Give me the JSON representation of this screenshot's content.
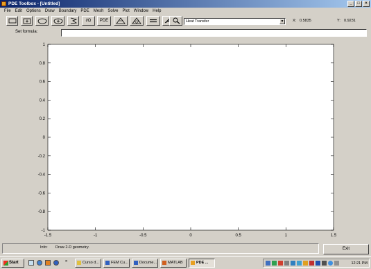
{
  "window": {
    "title": "PDE Toolbox - [Untitled]"
  },
  "window_buttons": [
    "_",
    "□",
    "×"
  ],
  "menu": [
    "File",
    "Edit",
    "Options",
    "Draw",
    "Boundary",
    "PDE",
    "Mesh",
    "Solve",
    "Plot",
    "Window",
    "Help"
  ],
  "toolbar": {
    "buttons": [
      {
        "name": "rectangle-icon"
      },
      {
        "name": "rectangle-centered-icon"
      },
      {
        "name": "ellipse-icon"
      },
      {
        "name": "ellipse-centered-icon"
      },
      {
        "name": "polygon-icon"
      },
      {
        "name": "boundary-mode-button",
        "label": "∂Ω"
      },
      {
        "name": "pde-spec-button",
        "label": "PDE"
      },
      {
        "name": "init-mesh-icon"
      },
      {
        "name": "refine-mesh-icon"
      },
      {
        "name": "solve-icon"
      },
      {
        "name": "plot-icon"
      },
      {
        "name": "zoom-icon"
      }
    ],
    "application_mode": "Heat Transfer",
    "x_label": "X:",
    "x_value": "0.5835",
    "y_label": "Y:",
    "y_value": "0.9231"
  },
  "formula": {
    "label": "Set formula:",
    "value": ""
  },
  "chart_data": {
    "type": "scatter",
    "title": "",
    "xlabel": "",
    "ylabel": "",
    "xlim": [
      -1.5,
      1.5
    ],
    "ylim": [
      -1,
      1
    ],
    "xticks": [
      "-1.5",
      "-1",
      "-0.5",
      "0",
      "0.5",
      "1",
      "1.5"
    ],
    "yticks": [
      "-1",
      "-0.8",
      "-0.6",
      "-0.4",
      "-0.2",
      "0",
      "0.2",
      "0.4",
      "0.6",
      "0.8",
      "1"
    ],
    "grid": false,
    "series": []
  },
  "status": {
    "info_label": "Info:",
    "info_text": "Draw 2-D geometry.",
    "exit_label": "Exit"
  },
  "taskbar": {
    "start_label": "Start",
    "more_label": "»",
    "tasks": [
      {
        "label": "Curso d...",
        "active": false
      },
      {
        "label": "FEM Cu...",
        "active": false
      },
      {
        "label": "Docume...",
        "active": false
      },
      {
        "label": "MATLAB",
        "active": false
      },
      {
        "label": "PDE ...",
        "active": true
      }
    ],
    "clock": "12:21 PM"
  },
  "colors": {
    "title_bar": "#0a246a",
    "chrome": "#d4d0c8",
    "plot_background": "#ffffff"
  }
}
